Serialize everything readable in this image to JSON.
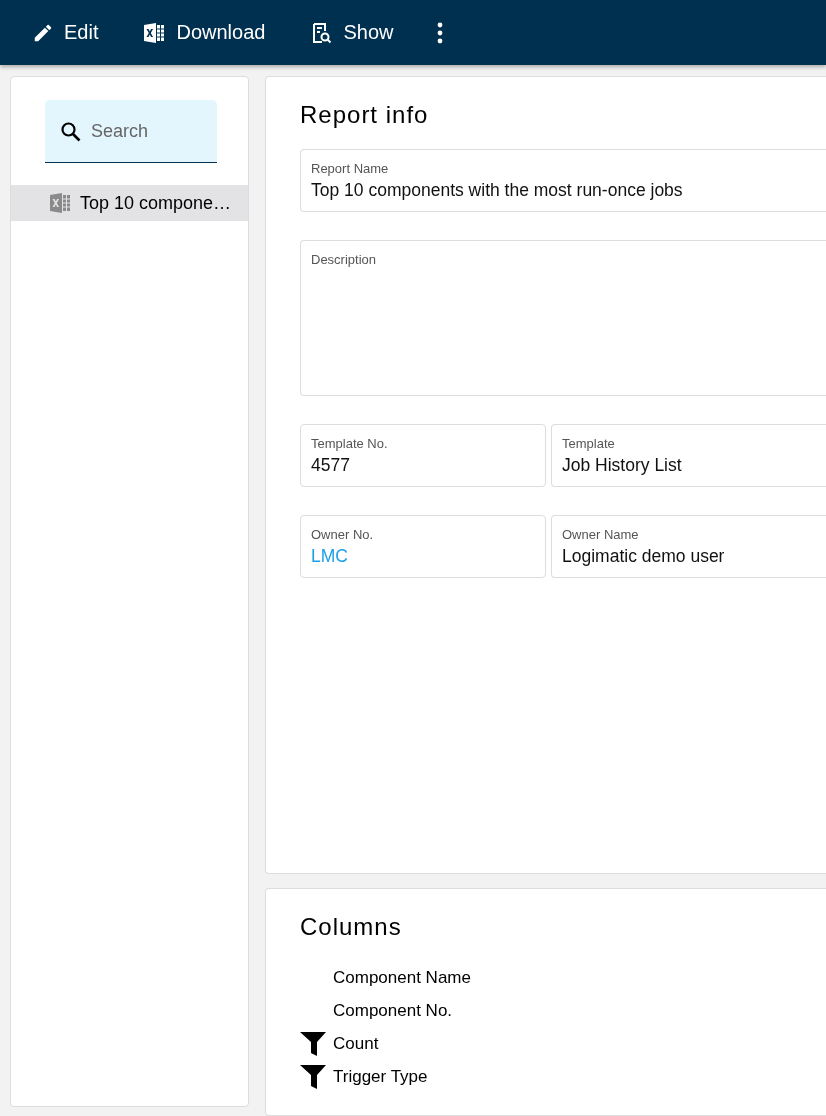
{
  "toolbar": [
    {
      "kind": "edit",
      "label": "Edit"
    },
    {
      "kind": "excel",
      "label": "Download"
    },
    {
      "kind": "show",
      "label": "Show"
    },
    {
      "kind": "more"
    }
  ],
  "sidebar": {
    "search": {
      "placeholder": "Search"
    },
    "items": [
      {
        "label": "Top 10 compone…",
        "selected": true
      }
    ]
  },
  "report_info": {
    "title": "Report info",
    "fields": [
      {
        "label": "Report Name",
        "value": "Top 10 components with the most run-once jobs",
        "kind": "full"
      },
      {
        "label": "Description",
        "kind": "area"
      },
      {
        "label": "Template No.",
        "value": "4577",
        "kind": "half"
      },
      {
        "label": "Template",
        "value": "Job History List",
        "kind": "half"
      },
      {
        "label": "Owner No.",
        "value": "LMC",
        "kind": "half",
        "link": true
      },
      {
        "label": "Owner Name",
        "value": "Logimatic demo user",
        "kind": "half",
        "link": false
      }
    ]
  },
  "columns": {
    "title": "Columns",
    "items": [
      {
        "label": "Component Name",
        "filtered": false
      },
      {
        "label": "Component No.",
        "filtered": false
      },
      {
        "label": "Count",
        "filtered": true
      },
      {
        "label": "Trigger Type",
        "filtered": true
      }
    ]
  }
}
